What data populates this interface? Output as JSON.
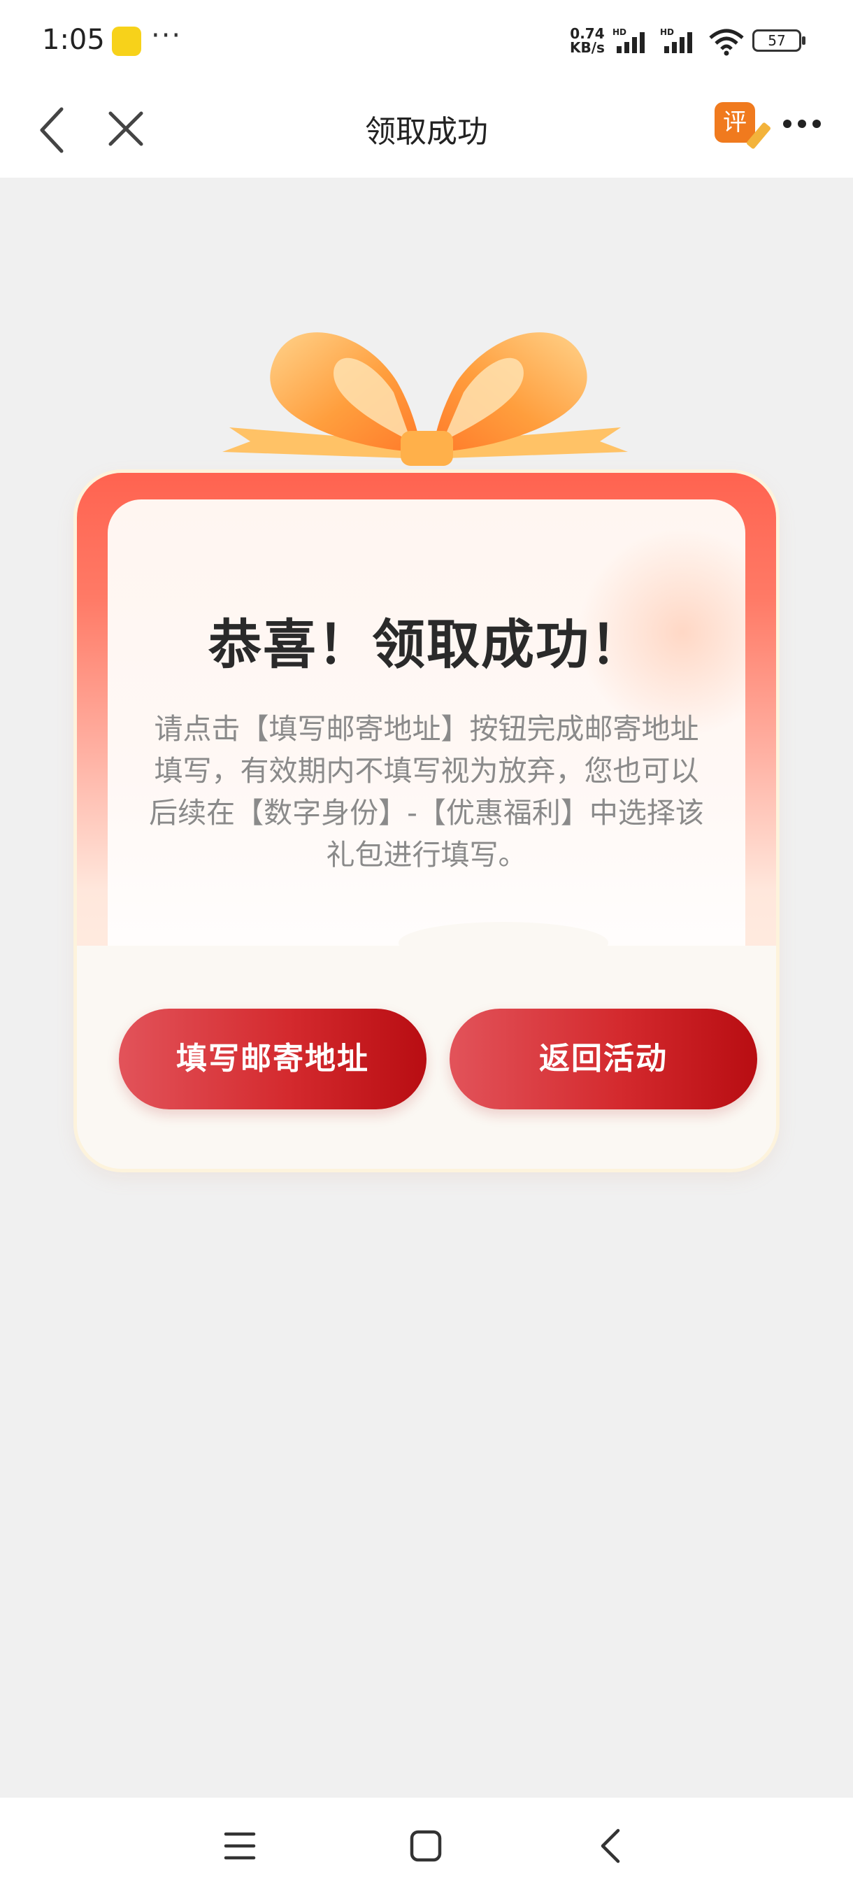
{
  "status_bar": {
    "time": "1:05",
    "more": "···",
    "speed_value": "0.74",
    "speed_unit": "KB/s",
    "battery": "57"
  },
  "nav": {
    "title": "领取成功",
    "review_label": "评"
  },
  "card": {
    "headline": "恭喜！领取成功！",
    "body": "请点击【填写邮寄地址】按钮完成邮寄地址填写，有效期内不填写视为放弃，您也可以后续在【数字身份】-【优惠福利】中选择该礼包进行填写。"
  },
  "buttons": {
    "fill_address": "填写邮寄地址",
    "return_activity": "返回活动"
  },
  "icons": {
    "app": "notification-app-icon",
    "signal": "signal-icon",
    "wifi": "wifi-icon",
    "back": "back-arrow-icon",
    "close": "close-icon",
    "more": "more-dots-icon",
    "gift_bow": "gift-bow-icon"
  },
  "colors": {
    "button_start": "#e2535a",
    "button_end": "#b80d12",
    "frame_top": "#ff6350",
    "review_badge": "#f07a1e"
  }
}
